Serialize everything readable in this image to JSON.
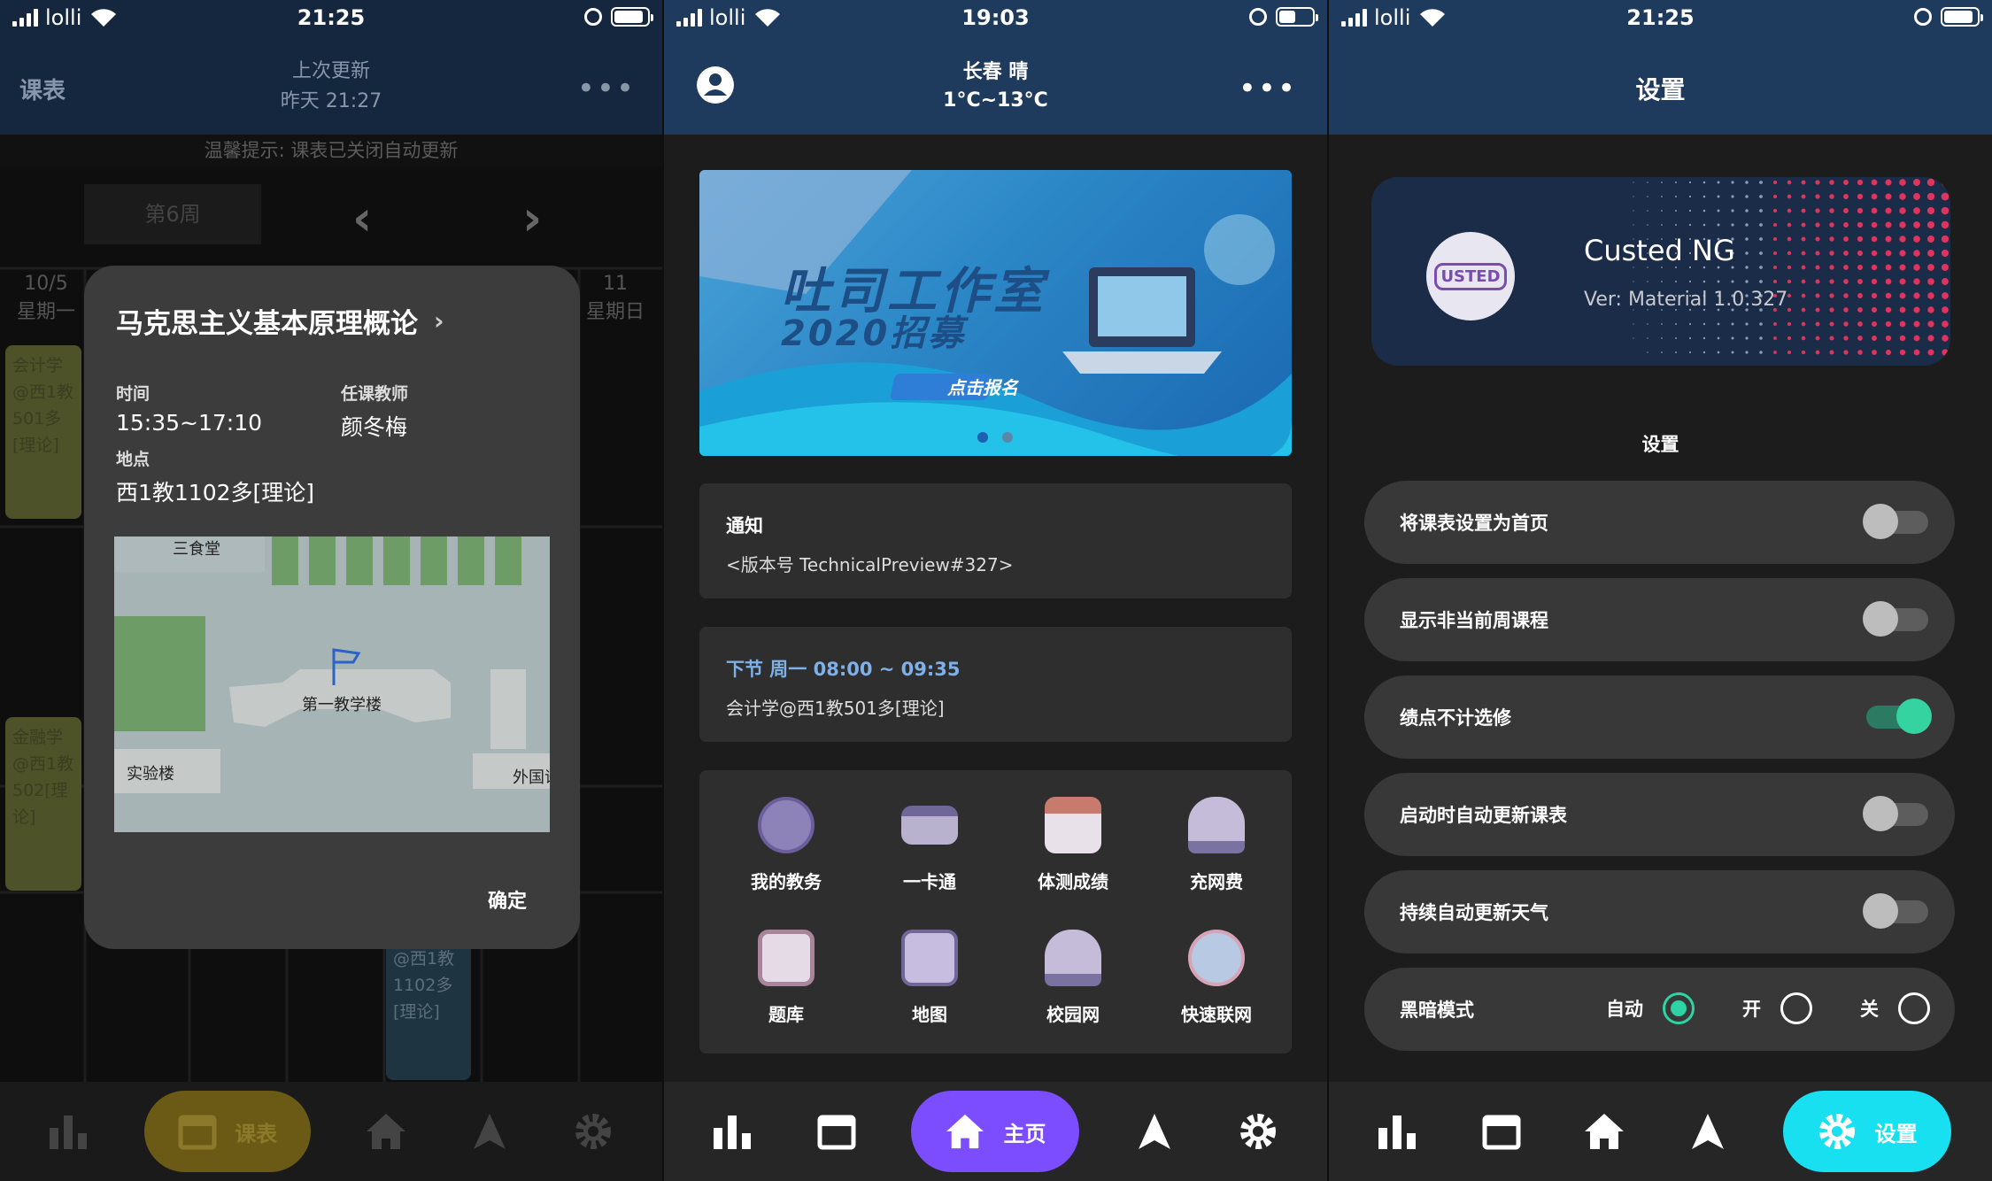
{
  "status": {
    "carrier": "lolli",
    "time_p1": "21:25",
    "time_p2": "19:03",
    "time_p3": "21:25"
  },
  "schedule": {
    "title": "课表",
    "last_update_label": "上次更新",
    "last_update_value": "昨天 21:27",
    "tip": "温馨提示: 课表已关闭自动更新",
    "week": "第6周",
    "col_left_date": "10/5",
    "col_left_day": "星期一",
    "col_right_date": "11",
    "col_right_day": "星期日",
    "course1": "会计学\n@西1教\n501多\n[理论]",
    "course2": "金融学\n@西1教\n502[理\n论]",
    "course3": "@西1教\n1102多\n[理论]",
    "dialog": {
      "title": "马克思主义基本原理概论",
      "time_label": "时间",
      "time_value": "15:35~17:10",
      "teacher_label": "任课教师",
      "teacher_value": "颜冬梅",
      "place_label": "地点",
      "place_value": "西1教1102多[理论]",
      "map_labels": {
        "canteen": "三食堂",
        "main": "第一教学楼",
        "lab": "实验楼",
        "foreign": "外国语"
      },
      "confirm": "确定"
    }
  },
  "home": {
    "city_weather": "长春 晴",
    "temperature": "1°C~13°C",
    "banner_line1": "吐司工作室",
    "banner_line2": "2020招募",
    "banner_button": "点击报名",
    "notice_title": "通知",
    "notice_body": "<版本号 TechnicalPreview#327>",
    "next_class_title": "下节 周一 08:00 ~ 09:35",
    "next_class_body": "会计学@西1教501多[理论]",
    "grid": [
      "我的教务",
      "一卡通",
      "体测成绩",
      "充网费",
      "题库",
      "地图",
      "校园网",
      "快速联网"
    ]
  },
  "settings": {
    "title": "设置",
    "app_name": "Custed NG",
    "version": "Ver: Material 1.0.327",
    "logo_text": "USTED",
    "section": "设置",
    "rows": [
      {
        "label": "将课表设置为首页",
        "on": false
      },
      {
        "label": "显示非当前周课程",
        "on": false
      },
      {
        "label": "绩点不计选修",
        "on": true
      },
      {
        "label": "启动时自动更新课表",
        "on": false
      },
      {
        "label": "持续自动更新天气",
        "on": false
      }
    ],
    "dark_mode_label": "黑暗模式",
    "dark_options": [
      "自动",
      "开",
      "关"
    ],
    "dark_selected": "自动"
  },
  "nav": {
    "schedule": "课表",
    "home": "主页",
    "settings": "设置"
  },
  "colors": {
    "appbar": "#1e3a5c",
    "home_pill": "#7c4dff",
    "settings_pill": "#18e0f0",
    "schedule_pill": "#6b5a16",
    "accent_green": "#2ed3a5"
  }
}
